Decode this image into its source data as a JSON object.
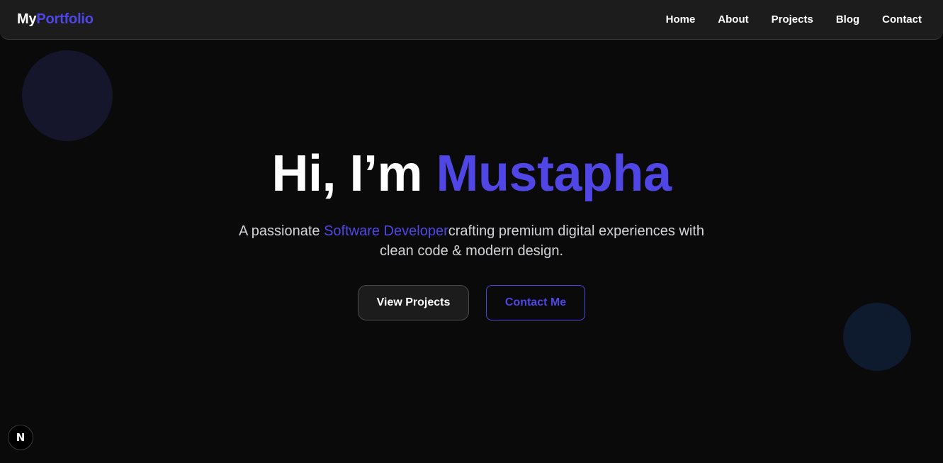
{
  "brand": {
    "part1": "My",
    "part2": "Portfolio"
  },
  "nav": {
    "items": [
      "Home",
      "About",
      "Projects",
      "Blog",
      "Contact"
    ]
  },
  "hero": {
    "title_prefix": "Hi, I’m ",
    "title_name": "Mustapha",
    "subtitle_before": "A passionate ",
    "subtitle_accent": "Software Developer",
    "subtitle_after": "crafting premium digital experiences with clean code & modern design.",
    "primary_button": "View Projects",
    "secondary_button": "Contact Me"
  },
  "dev_indicator": {
    "icon": "nextjs-logo-icon",
    "glyph": "N"
  },
  "colors": {
    "accent": "#4f46e5",
    "background": "#0a0a0a",
    "navbar": "#1c1c1c"
  }
}
